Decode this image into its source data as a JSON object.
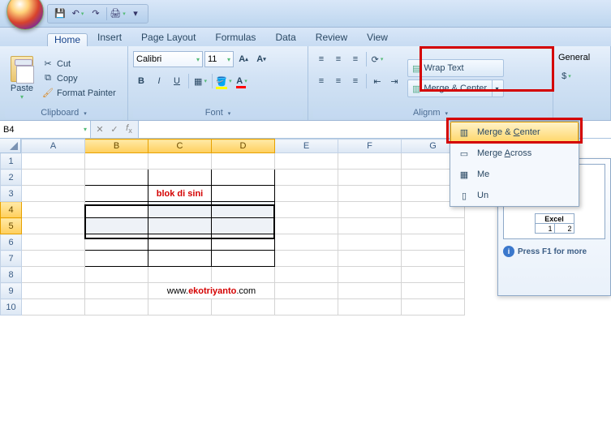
{
  "qat": {
    "save_title": "Save",
    "undo_title": "Undo",
    "redo_title": "Redo",
    "qprint_title": "Quick Print"
  },
  "tabs": [
    "Home",
    "Insert",
    "Page Layout",
    "Formulas",
    "Data",
    "Review",
    "View"
  ],
  "active_tab": "Home",
  "clipboard": {
    "paste": "Paste",
    "cut": "Cut",
    "copy": "Copy",
    "painter": "Format Painter",
    "label": "Clipboard"
  },
  "font": {
    "name": "Calibri",
    "size": "11",
    "label": "Font"
  },
  "alignment": {
    "wrap": "Wrap Text",
    "merge": "Merge & Center",
    "label": "Alignm"
  },
  "number": {
    "format": "General"
  },
  "merge_menu": {
    "merge_center": "Merge & Center",
    "merge_across": "Merge Across",
    "merge_cells": "Me",
    "unmerge": "Un"
  },
  "tt": {
    "label1": "Excel",
    "v1": "1",
    "v2": "2",
    "label2": "Excel",
    "v3": "1",
    "v4": "2",
    "help": "Press F1 for more"
  },
  "namebox": "B4",
  "columns": [
    "A",
    "B",
    "C",
    "D",
    "E",
    "F",
    "G"
  ],
  "rows": [
    "1",
    "2",
    "3",
    "4",
    "5",
    "6",
    "7",
    "8",
    "9",
    "10"
  ],
  "annotation": "blok di sini",
  "watermark_pre": "www.",
  "watermark_mid": "ekotriyanto",
  "watermark_post": ".com"
}
